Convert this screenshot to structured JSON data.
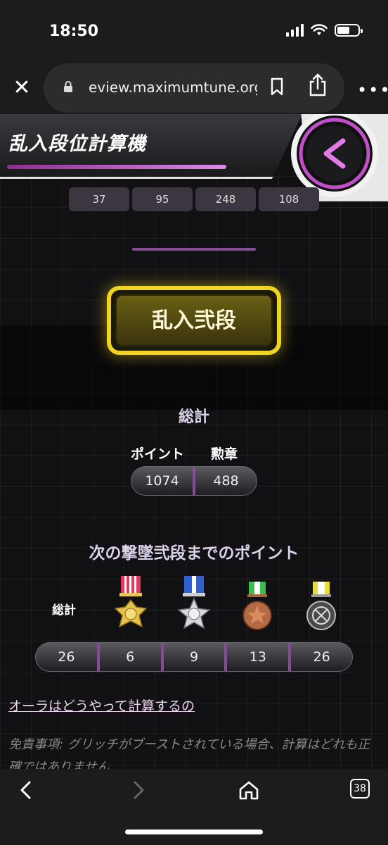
{
  "status": {
    "time": "18:50"
  },
  "browser": {
    "url": "eview.maximumtune.org",
    "tab_count": "38"
  },
  "header": {
    "title": "乱入段位計算機"
  },
  "tabs": [
    "37",
    "95",
    "248",
    "108"
  ],
  "rank": {
    "label": "乱入弐段"
  },
  "totals": {
    "title": "総計",
    "points_label": "ポイント",
    "medals_label": "勲章",
    "points": "1074",
    "medals": "488"
  },
  "next": {
    "title": "次の撃墜弐段までのポイント",
    "total_label": "総計",
    "values": [
      "26",
      "6",
      "9",
      "13",
      "26"
    ]
  },
  "links": {
    "aura": "オーラはどうやって計算するの"
  },
  "disclaimer": "免責事項: グリッチがブーストされている場合、計算はどれも正確ではありません",
  "colors": {
    "accent_purple": "#8a4a9a",
    "rank_gold": "#f1d321"
  }
}
